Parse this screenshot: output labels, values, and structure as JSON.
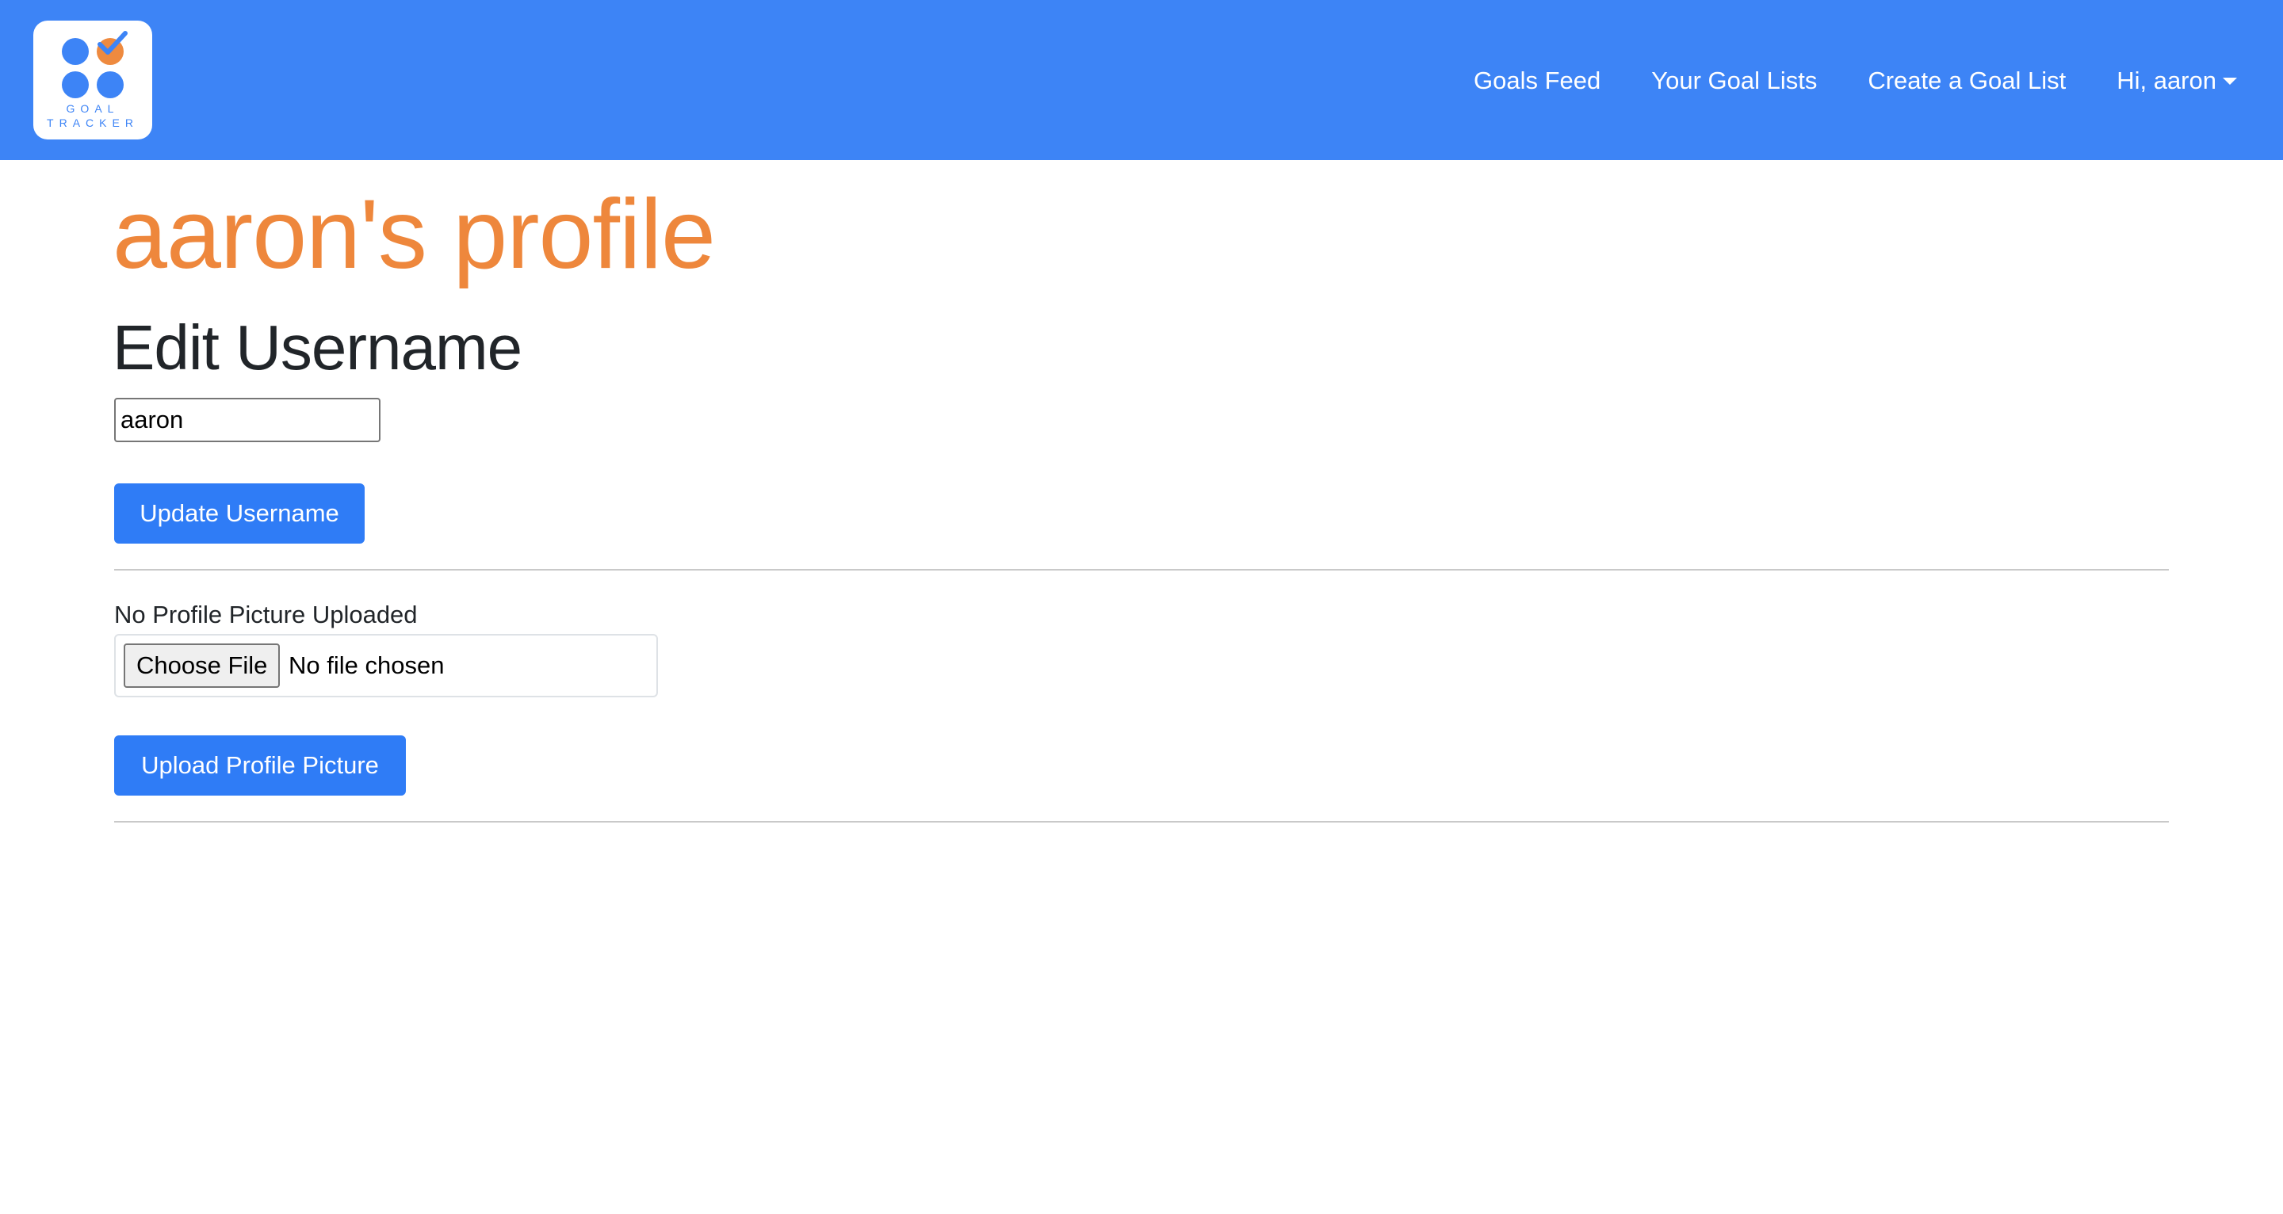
{
  "navbar": {
    "logo": {
      "line1": "GOAL",
      "line2": "TRACKER",
      "colors": {
        "primary": "#3d84f6",
        "accent": "#ee8a3f"
      }
    },
    "links": {
      "goals_feed": "Goals Feed",
      "your_goal_lists": "Your Goal Lists",
      "create_goal_list": "Create a Goal List",
      "user_menu": "Hi, aaron"
    },
    "background_color": "#3d84f6"
  },
  "main": {
    "title": "aaron's profile",
    "title_color": "#ee873c",
    "edit_username": {
      "heading": "Edit Username",
      "input_value": "aaron",
      "button_label": "Update Username"
    },
    "profile_picture": {
      "status_text": "No Profile Picture Uploaded",
      "choose_file_label": "Choose File",
      "file_status": "No file chosen",
      "button_label": "Upload Profile Picture"
    },
    "button_color": "#2f7cf6"
  }
}
